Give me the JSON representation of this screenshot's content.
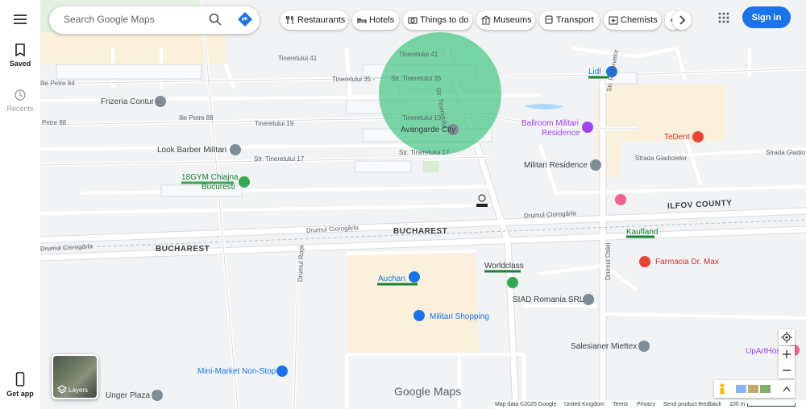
{
  "rail": {
    "saved": "Saved",
    "recents": "Recents",
    "get_app": "Get app"
  },
  "search": {
    "placeholder": "Search Google Maps"
  },
  "chips": [
    {
      "label": "Restaurants",
      "icon": "fork-knife-icon"
    },
    {
      "label": "Hotels",
      "icon": "bed-icon"
    },
    {
      "label": "Things to do",
      "icon": "camera-icon"
    },
    {
      "label": "Museums",
      "icon": "museum-icon"
    },
    {
      "label": "Transport",
      "icon": "bus-icon"
    },
    {
      "label": "Chemists",
      "icon": "pharmacy-icon"
    }
  ],
  "header": {
    "sign_in": "Sign in"
  },
  "layers": {
    "label": "Layers"
  },
  "logo": "Google Maps",
  "footer": {
    "map_data": "Map data ©2025 Google",
    "region": "United Kingdom",
    "terms": "Terms",
    "privacy": "Privacy",
    "feedback": "Send product feedback",
    "scale": "100 m"
  },
  "map_labels": {
    "tineretului_41": "Tineretului 41",
    "tineretului_41b": "Tineretului 41",
    "str_tineretului_35": "Str. Tineretului 35",
    "str_tineretului_35b": "Str. Tineretului 35",
    "tineretului_35_prefix": "Tineretului 35 -",
    "str_tineretului_v": "Str. Tineretului",
    "tineretului_19": "Tineretului 19",
    "tineretului_19b": "Tineretului 19",
    "str_tineretului_17": "Str. Tineretului 17",
    "str_tineretului_17b": "Str. Tineretului 17",
    "ilie_petre_84": "Ilie Petre 84",
    "ilie_petre_88": "Ilie Petre 88",
    "ilie_petre_88b": "Petre 88",
    "frizeria": "Frizeria Contur",
    "look_barber": "Look Barber Militari",
    "gym_1": "18GYM Chiajna",
    "gym_2": "Bucuresti",
    "avangarde": "Avangarde City",
    "lidl": "Lidl",
    "ballroom_1": "Ballroom Militari",
    "ballroom_2": "Residence",
    "tedent": "TeDent",
    "strada_gladiolelor": "Strada Gladiolelor",
    "strada_gladio": "Strada Gladio",
    "militari_residence": "Militari Residence",
    "str_rezervelor": "Str. Rezervelor",
    "ilfov_county": "ILFOV COUNTY",
    "drumul_ciorogarla_1": "Drumul Ciorogârla",
    "drumul_ciorogarla_2": "Drumul Ciorogârla",
    "drumul_ciorogarla_3": "Drumul Ciorogârla",
    "bucharest_1": "BUCHAREST",
    "bucharest_2": "BUCHAREST",
    "kaufland": "Kaufland",
    "farmacia": "Farmacia Dr. Max",
    "worldclass": "Worldclass",
    "auchan": "Auchan",
    "siad": "SIAD Romania SRL",
    "militari_shopping": "Militari Shopping",
    "drumul_osiei": "Drumul Osiei",
    "drumul_rojii": "Drumul Roșii",
    "salesianer": "Salesianer Miettex",
    "upart": "UpArtHost",
    "minimarket": "Mini-Market Non-Stop",
    "unger": "Unger Plaza"
  }
}
